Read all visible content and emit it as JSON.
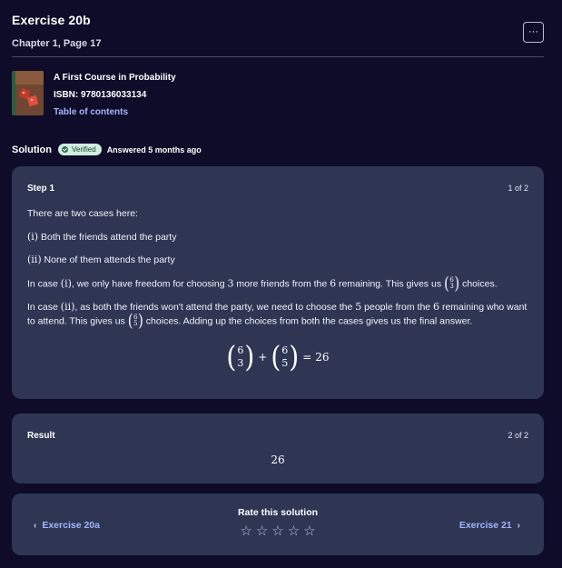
{
  "header": {
    "title": "Exercise 20b",
    "subtitle": "Chapter 1, Page 17",
    "more_label": "···"
  },
  "book": {
    "title": "A First Course in Probability",
    "isbn": "ISBN: 9780136033134",
    "toc_label": "Table of contents"
  },
  "solution": {
    "label": "Solution",
    "badge": "Verified",
    "answered": "Answered 5 months ago"
  },
  "step": {
    "title": "Step 1",
    "count": "1 of 2",
    "intro": "There are two cases here:",
    "case1_label": "(i)",
    "case1_text": " Both the friends attend the party",
    "case2_label": "(ii)",
    "case2_text": " None of them attends the party",
    "p3_a": "In case ",
    "p3_case": "(i)",
    "p3_b": ", we only have freedom for choosing ",
    "p3_n1": "3",
    "p3_c": " more friends from the ",
    "p3_n2": "6",
    "p3_d": " remaining. This gives us ",
    "p3_binom_top": "6",
    "p3_binom_bottom": "3",
    "p3_e": " choices.",
    "p4_a": "In case ",
    "p4_case": "(ii)",
    "p4_b": ", as both the friends won't attend the party, we need to choose the ",
    "p4_n1": "5",
    "p4_c": " people from the ",
    "p4_n2": "6",
    "p4_d": " remaining who want to attend. This gives us ",
    "p4_binom_top": "6",
    "p4_binom_bottom": "5",
    "p4_e": " choices. Adding up the choices from both the cases gives us the final answer.",
    "formula": {
      "b1_top": "6",
      "b1_bottom": "3",
      "plus": "+",
      "b2_top": "6",
      "b2_bottom": "5",
      "equals": "=",
      "result": "26"
    }
  },
  "result": {
    "title": "Result",
    "count": "2 of 2",
    "value": "26"
  },
  "rating": {
    "title": "Rate this solution",
    "prev_label": "Exercise 20a",
    "next_label": "Exercise 21",
    "star_count": 5
  }
}
